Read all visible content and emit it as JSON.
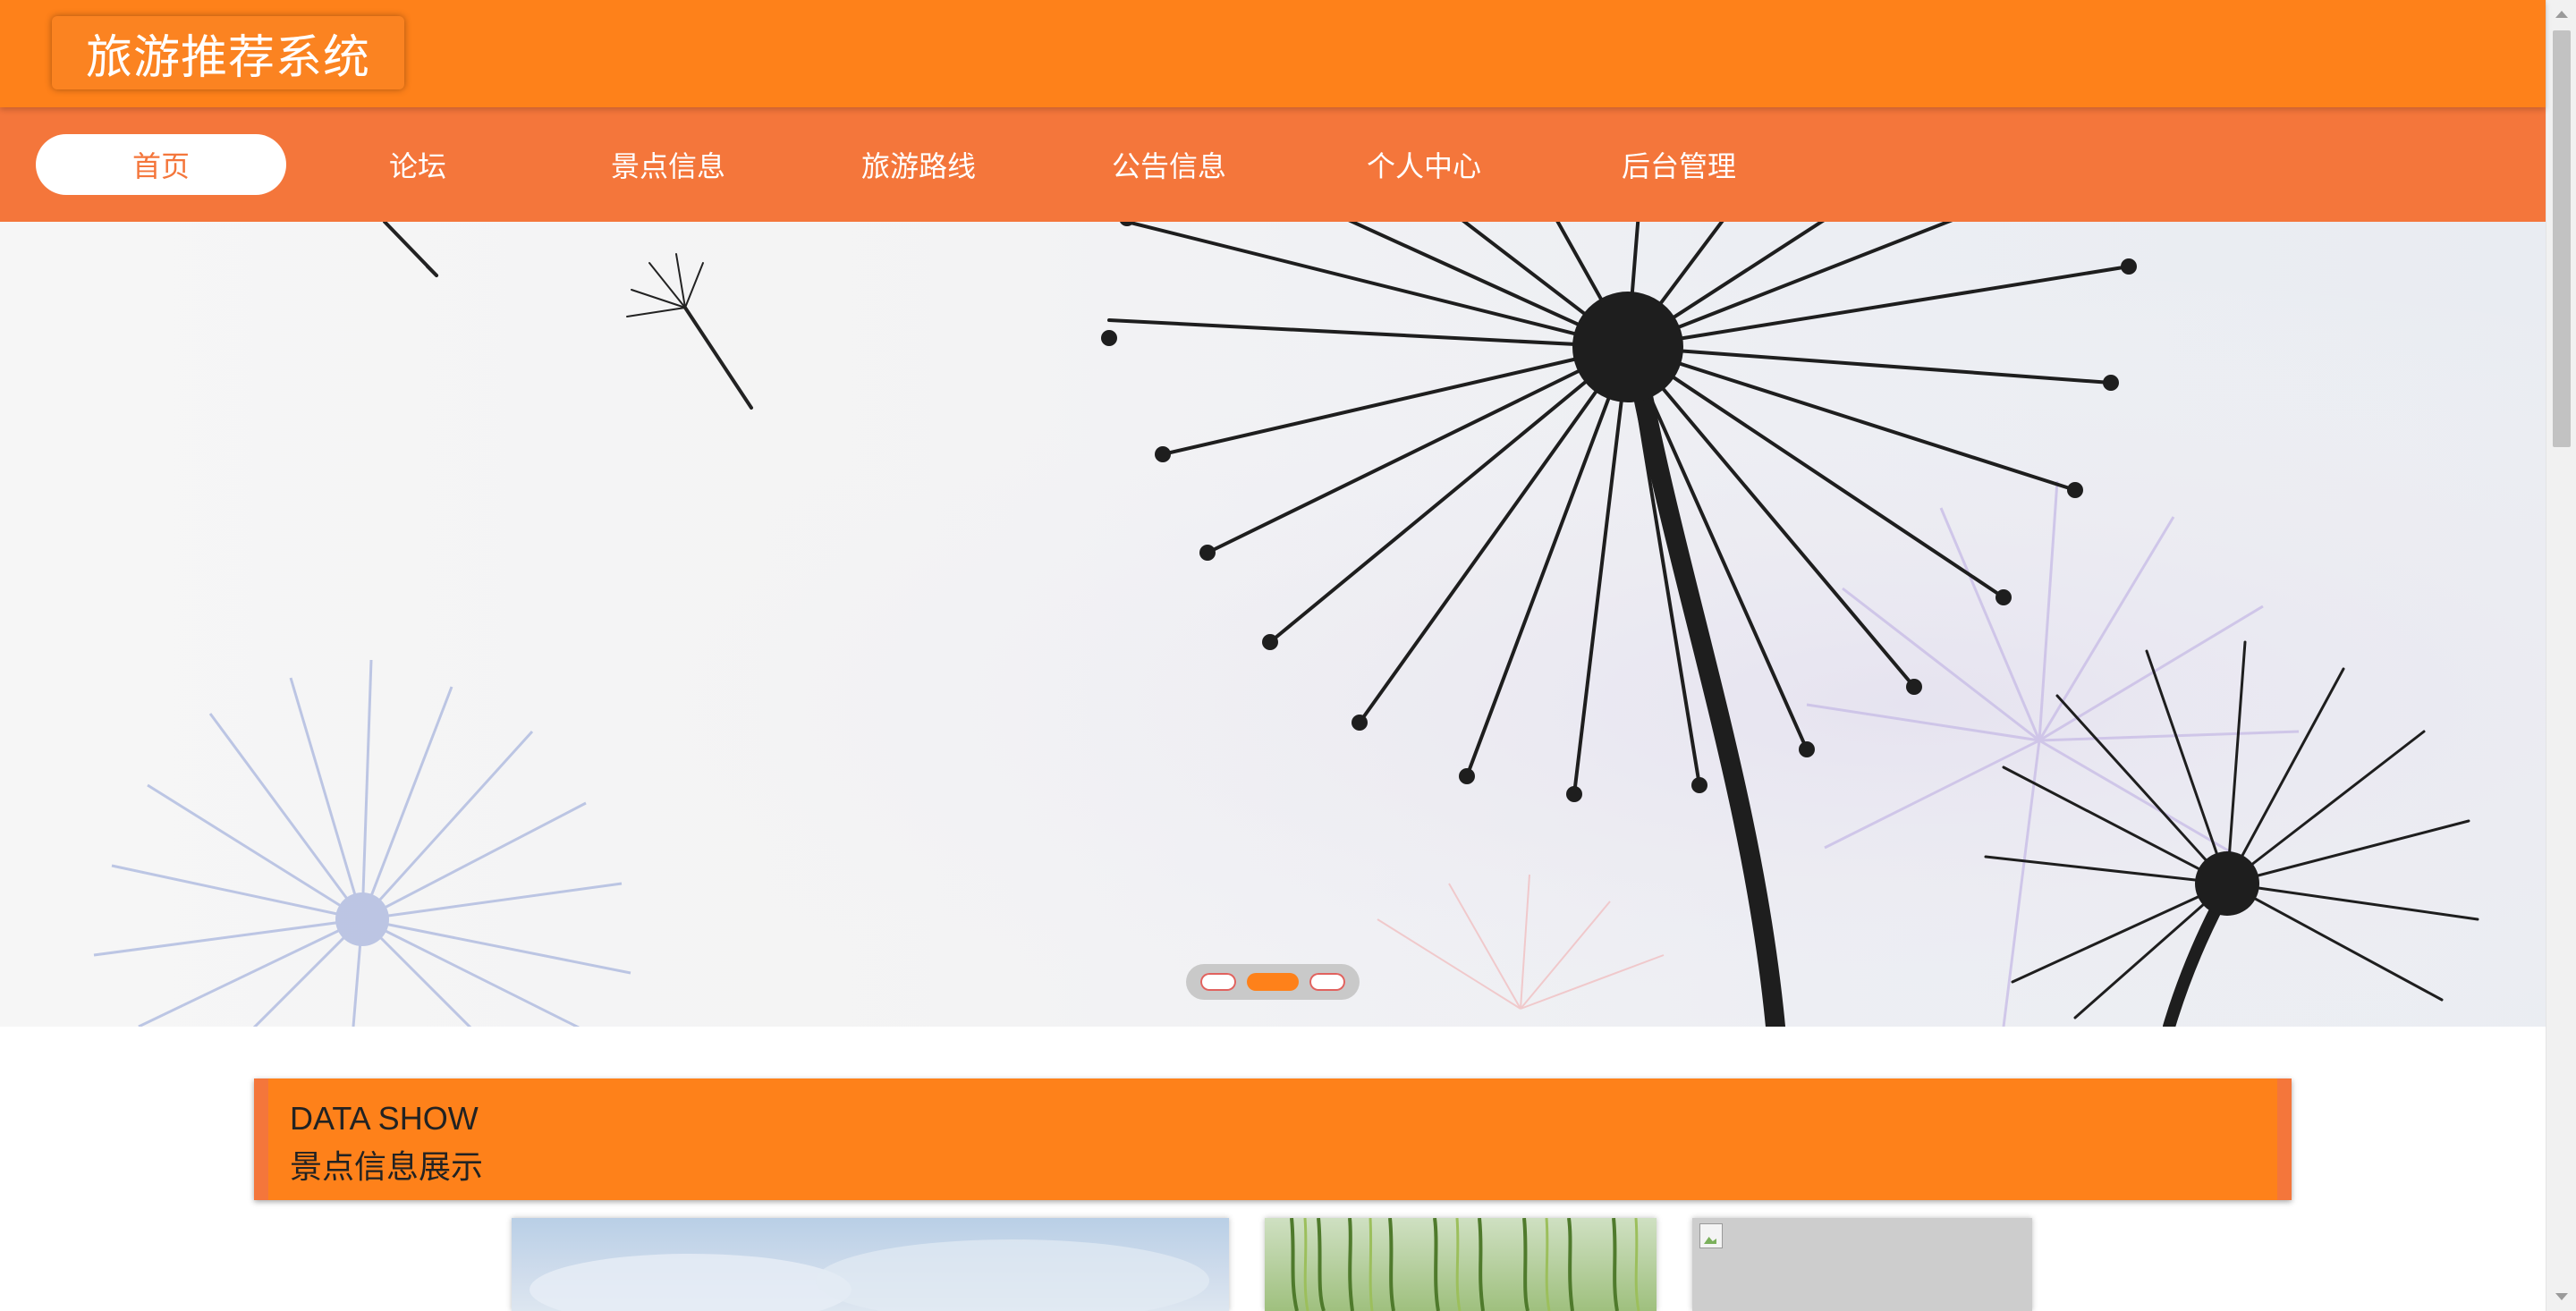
{
  "header": {
    "title": "旅游推荐系统"
  },
  "nav": {
    "items": [
      {
        "label": "首页",
        "active": true
      },
      {
        "label": "论坛",
        "active": false
      },
      {
        "label": "景点信息",
        "active": false
      },
      {
        "label": "旅游路线",
        "active": false
      },
      {
        "label": "公告信息",
        "active": false
      },
      {
        "label": "个人中心",
        "active": false
      },
      {
        "label": "后台管理",
        "active": false
      }
    ]
  },
  "banner": {
    "image": "dandelion-illustration",
    "carousel": {
      "count": 3,
      "active_index": 1
    }
  },
  "section": {
    "title_en": "DATA SHOW",
    "title_cn": "景点信息展示"
  },
  "cards": [
    {
      "image": "sky-photo"
    },
    {
      "image": "willow-tree-photo"
    },
    {
      "image": "broken-image-icon"
    }
  ],
  "colors": {
    "header_bg": "#fe811a",
    "nav_bg": "#f4763b",
    "accent": "#fe811a",
    "text_on_accent": "#ffffff"
  }
}
